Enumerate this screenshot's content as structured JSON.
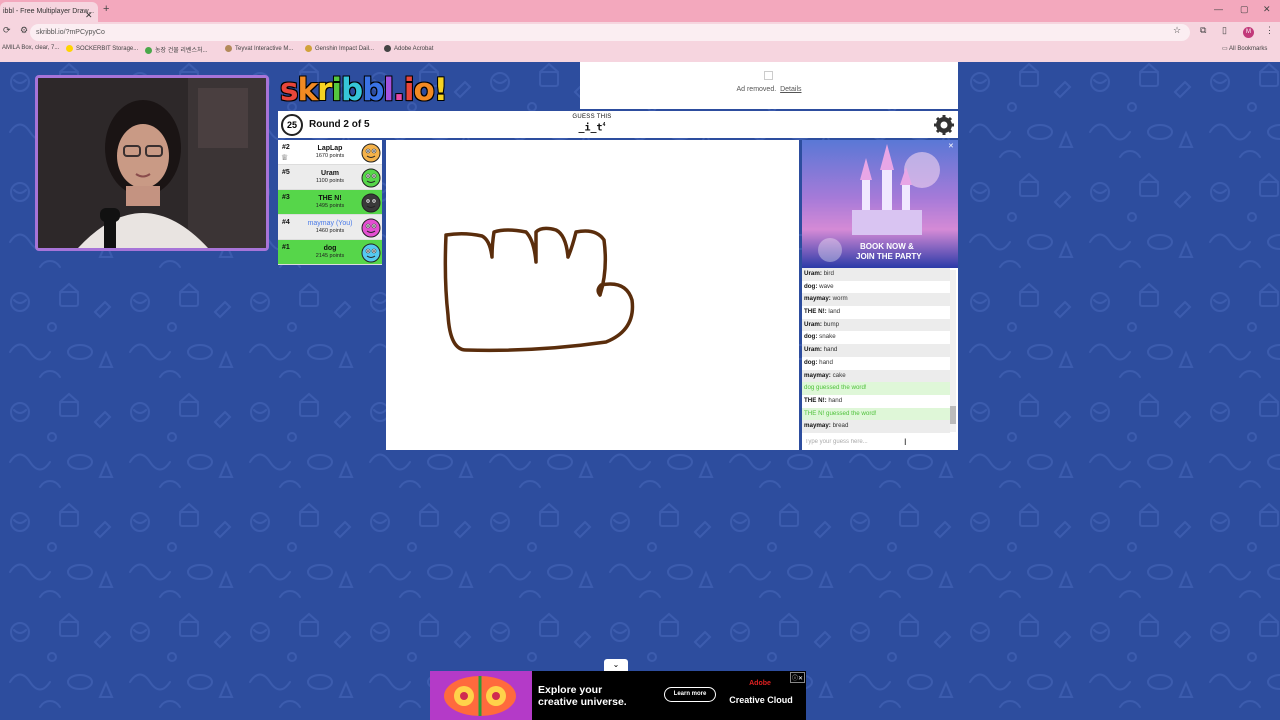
{
  "browser": {
    "tab_title": "ibbl - Free Multiplayer Draw...",
    "tab_close": "✕",
    "new_tab": "+",
    "url": "skribbl.io/?mPCypyCo",
    "window_controls": [
      "—",
      "▢",
      "✕"
    ],
    "bookmarks": [
      {
        "label": "AMILA Box, clear, 7...",
        "color": "#3a3a3a"
      },
      {
        "label": "SOCKERBIT Storage...",
        "color": "#ffd400"
      },
      {
        "label": "농장 건물 리벤스처...",
        "color": "#4aa84a"
      },
      {
        "label": "Teyvat Interactive M...",
        "color": "#b38a5a"
      },
      {
        "label": "Genshin Impact Dail...",
        "color": "#d1a23a"
      },
      {
        "label": "Adobe Acrobat",
        "color": "#444444"
      }
    ],
    "all_bookmarks": "All Bookmarks"
  },
  "ad_top": {
    "removed_text": "Ad removed.",
    "details_link": "Details"
  },
  "logo": {
    "letters": [
      "s",
      "k",
      "r",
      "i",
      "b",
      "b",
      "l",
      ".",
      "i",
      "o",
      "!"
    ],
    "colors": [
      "#e8463a",
      "#f28a23",
      "#f5d222",
      "#55c73e",
      "#36c6d8",
      "#3a73e6",
      "#a452e0",
      "#e84aa6",
      "#e8463a",
      "#f28a23",
      "#f5d222"
    ]
  },
  "header": {
    "timer": "25",
    "round": "Round 2 of 5",
    "guess_title": "GUESS THIS",
    "word_pattern": "_i_t",
    "word_length": "4"
  },
  "players": [
    {
      "rank": "#2",
      "name": "LapLap",
      "points": "1670 points",
      "state": "normal",
      "you": false,
      "avatar_color": "#f4b24a",
      "crown": "♕"
    },
    {
      "rank": "#5",
      "name": "Uram",
      "points": "1100 points",
      "state": "alt",
      "you": false,
      "avatar_color": "#56d64a",
      "crown": ""
    },
    {
      "rank": "#3",
      "name": "THE N!",
      "points": "1495 points",
      "state": "guessed",
      "you": false,
      "avatar_color": "#3a3a3a",
      "crown": ""
    },
    {
      "rank": "#4",
      "name": "maymay (You)",
      "points": "1460 points",
      "state": "alt",
      "you": true,
      "avatar_color": "#e44fd1",
      "crown": ""
    },
    {
      "rank": "#1",
      "name": "dog",
      "points": "2145 points",
      "state": "guessed",
      "you": false,
      "avatar_color": "#56c9f0",
      "crown": ""
    }
  ],
  "ad_side": {
    "line1": "BOOK NOW &",
    "line2": "JOIN THE PARTY",
    "close": "✕"
  },
  "chat": {
    "messages": [
      {
        "user": "Uram",
        "text": "bird",
        "type": "alt"
      },
      {
        "user": "dog",
        "text": "wave",
        "type": "normal"
      },
      {
        "user": "maymay",
        "text": "worm",
        "type": "alt"
      },
      {
        "user": "THE N!",
        "text": "land",
        "type": "normal"
      },
      {
        "user": "Uram",
        "text": "bump",
        "type": "alt"
      },
      {
        "user": "dog",
        "text": "snake",
        "type": "normal"
      },
      {
        "user": "Uram",
        "text": "hand",
        "type": "alt"
      },
      {
        "user": "dog",
        "text": "hand",
        "type": "normal"
      },
      {
        "user": "maymay",
        "text": "cake",
        "type": "alt"
      },
      {
        "user": "",
        "text": "dog guessed the word!",
        "type": "correct"
      },
      {
        "user": "THE N!",
        "text": "hand",
        "type": "normal"
      },
      {
        "user": "",
        "text": "THE N! guessed the word!",
        "type": "correct"
      },
      {
        "user": "maymay",
        "text": "bread",
        "type": "alt"
      }
    ],
    "input_placeholder": "Type your guess here..."
  },
  "ad_bottom": {
    "toggle": "⌄",
    "headline1": "Explore your",
    "headline2": "creative universe.",
    "button": "Learn more",
    "brand1": "Adobe",
    "brand2": "Creative Cloud",
    "close": "ⓘ✕"
  }
}
